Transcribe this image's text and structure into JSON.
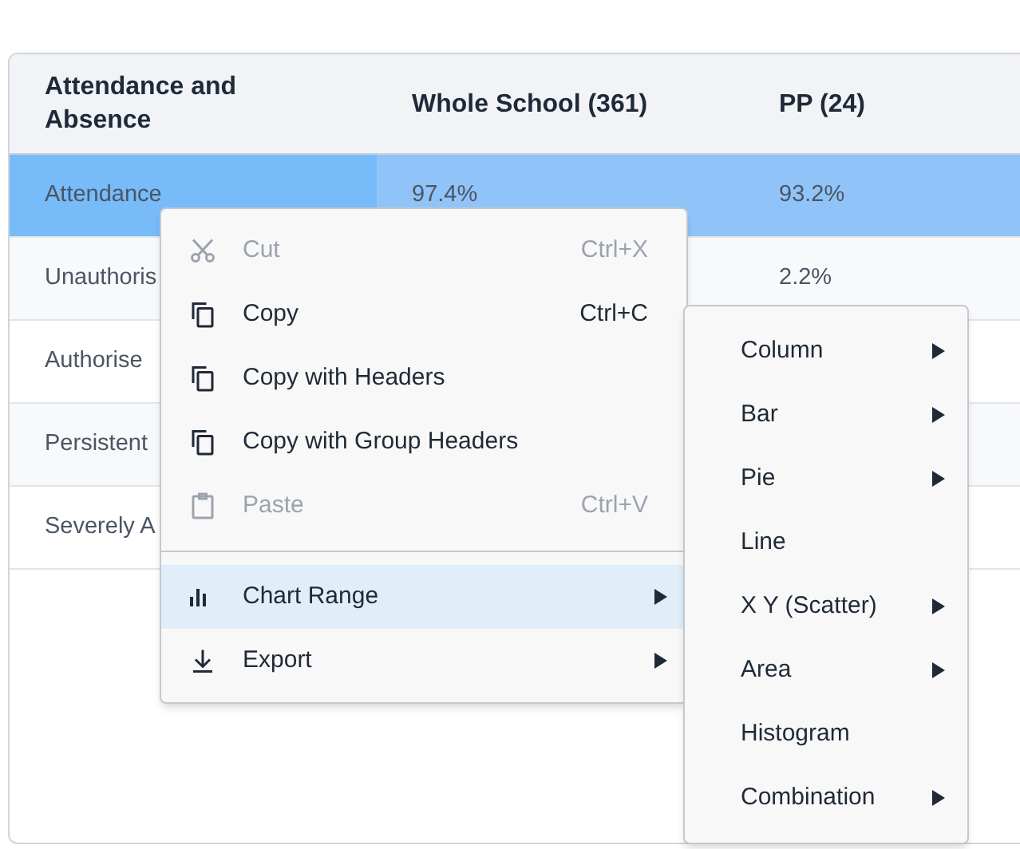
{
  "table": {
    "columns": [
      "Attendance and Absence",
      "Whole School (361)",
      "PP (24)"
    ],
    "rows": [
      {
        "cells": [
          "Attendance",
          "97.4%",
          "93.2%"
        ],
        "selected": true
      },
      {
        "cells": [
          "Unauthoris",
          "",
          "2.2%"
        ],
        "selected": false
      },
      {
        "cells": [
          "Authorise",
          "",
          ""
        ],
        "selected": false
      },
      {
        "cells": [
          "Persistent",
          "",
          ""
        ],
        "selected": false
      },
      {
        "cells": [
          "Severely A",
          "",
          ""
        ],
        "selected": false
      }
    ]
  },
  "context_menu": {
    "items": [
      {
        "kind": "cut",
        "label": "Cut",
        "shortcut": "Ctrl+X",
        "disabled": true,
        "submenu": false,
        "selected": false
      },
      {
        "kind": "copy",
        "label": "Copy",
        "shortcut": "Ctrl+C",
        "disabled": false,
        "submenu": false,
        "selected": false
      },
      {
        "kind": "copy",
        "label": "Copy with Headers",
        "disabled": false,
        "submenu": false,
        "selected": false
      },
      {
        "kind": "copy",
        "label": "Copy with Group Headers",
        "disabled": false,
        "submenu": false,
        "selected": false
      },
      {
        "kind": "paste",
        "label": "Paste",
        "shortcut": "Ctrl+V",
        "disabled": true,
        "submenu": false,
        "selected": false
      },
      {
        "kind": "separator"
      },
      {
        "kind": "chart",
        "label": "Chart Range",
        "disabled": false,
        "submenu": true,
        "selected": true
      },
      {
        "kind": "export",
        "label": "Export",
        "disabled": false,
        "submenu": true,
        "selected": false
      }
    ]
  },
  "submenu": {
    "items": [
      {
        "label": "Column",
        "submenu": true
      },
      {
        "label": "Bar",
        "submenu": true
      },
      {
        "label": "Pie",
        "submenu": true
      },
      {
        "label": "Line",
        "submenu": false
      },
      {
        "label": "X Y (Scatter)",
        "submenu": true
      },
      {
        "label": "Area",
        "submenu": true
      },
      {
        "label": "Histogram",
        "submenu": false
      },
      {
        "label": "Combination",
        "submenu": true
      }
    ]
  }
}
